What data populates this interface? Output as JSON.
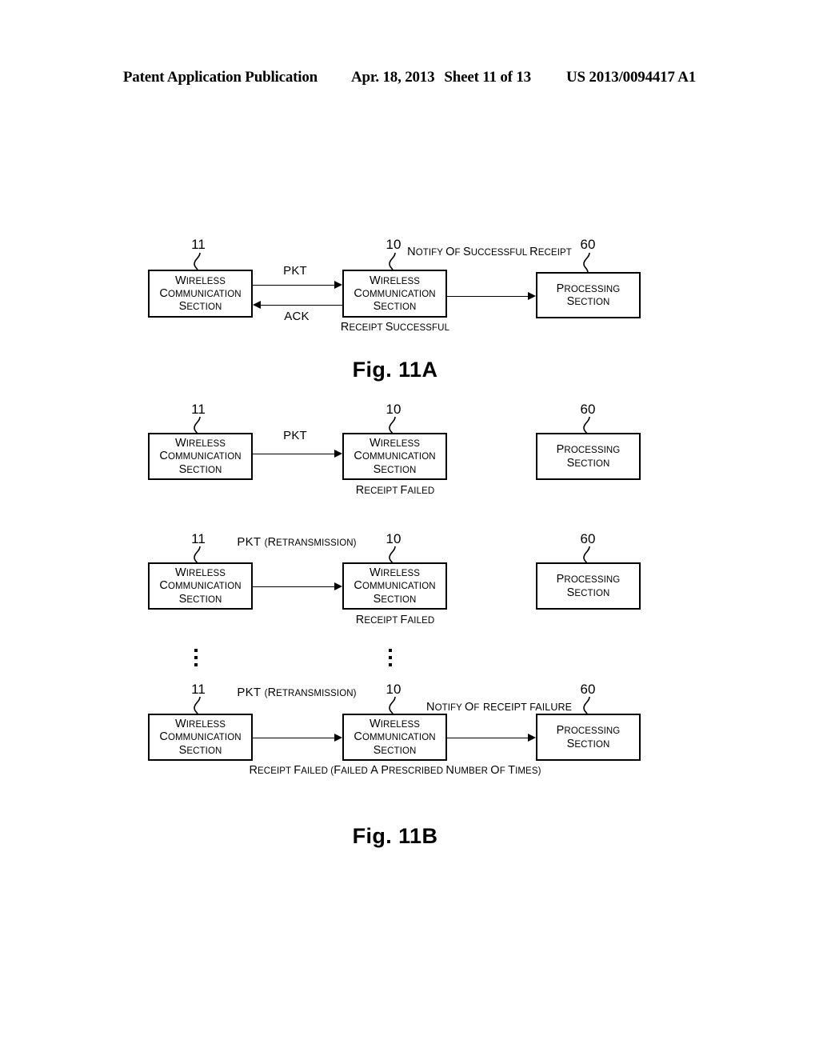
{
  "header": {
    "publication": "Patent Application Publication",
    "date": "Apr. 18, 2013",
    "sheet": "Sheet 11 of 13",
    "patent_number": "US 2013/0094417 A1"
  },
  "figures": [
    {
      "caption": "Fig. 11A",
      "rows": [
        {
          "id": "row-a1",
          "left_box": {
            "ref": "11",
            "lines": [
              "WIRELESS",
              "COMMUNICATION",
              "SECTION"
            ]
          },
          "middle_box": {
            "ref": "10",
            "lines": [
              "WIRELESS",
              "COMMUNICATION",
              "SECTION"
            ],
            "below_lines": [
              "RECEIPT",
              "SUCCESSFUL"
            ]
          },
          "right_box": {
            "ref": "60",
            "lines": [
              "PROCESSING",
              "SECTION"
            ]
          },
          "arrow_forward_label": [
            "PKT"
          ],
          "arrow_back_label": [
            "ACK"
          ],
          "arrow_right_label": [
            "NOTIFY OF",
            "SUCCESSFUL",
            "RECEIPT"
          ]
        }
      ]
    },
    {
      "caption": "Fig. 11B",
      "rows": [
        {
          "id": "row-b1",
          "left_box": {
            "ref": "11",
            "lines": [
              "WIRELESS",
              "COMMUNICATION",
              "SECTION"
            ]
          },
          "middle_box": {
            "ref": "10",
            "lines": [
              "WIRELESS",
              "COMMUNICATION",
              "SECTION"
            ],
            "below_lines": [
              "RECEIPT FAILED"
            ]
          },
          "right_box": {
            "ref": "60",
            "lines": [
              "PROCESSING",
              "SECTION"
            ]
          },
          "arrow_forward_label": [
            "PKT"
          ]
        },
        {
          "id": "row-b2",
          "left_box": {
            "ref": "11",
            "lines": [
              "WIRELESS",
              "COMMUNICATION",
              "SECTION"
            ]
          },
          "middle_box": {
            "ref": "10",
            "lines": [
              "WIRELESS",
              "COMMUNICATION",
              "SECTION"
            ],
            "below_lines": [
              "RECEIPT FAILED"
            ]
          },
          "right_box": {
            "ref": "60",
            "lines": [
              "PROCESSING",
              "SECTION"
            ]
          },
          "arrow_forward_label": [
            "PKT",
            "(RETRANSMISSION)"
          ]
        },
        {
          "id": "row-b3",
          "left_box": {
            "ref": "11",
            "lines": [
              "WIRELESS",
              "COMMUNICATION",
              "SECTION"
            ]
          },
          "middle_box": {
            "ref": "10",
            "lines": [
              "WIRELESS",
              "COMMUNICATION",
              "SECTION"
            ],
            "below_lines": [
              "RECEIPT FAILED",
              "(FAILED A PRESCRIBED",
              "NUMBER OF TIMES)"
            ]
          },
          "right_box": {
            "ref": "60",
            "lines": [
              "PROCESSING",
              "SECTION"
            ]
          },
          "arrow_forward_label": [
            "PKT",
            "(RETRANSMISSION)"
          ],
          "arrow_right_label": [
            "NOTIFY OF",
            "RECEIPT FAILURE"
          ]
        }
      ]
    }
  ],
  "ellipsis": {
    "dot_count": 3
  },
  "colors": {
    "ink": "#000000",
    "paper": "#ffffff"
  }
}
